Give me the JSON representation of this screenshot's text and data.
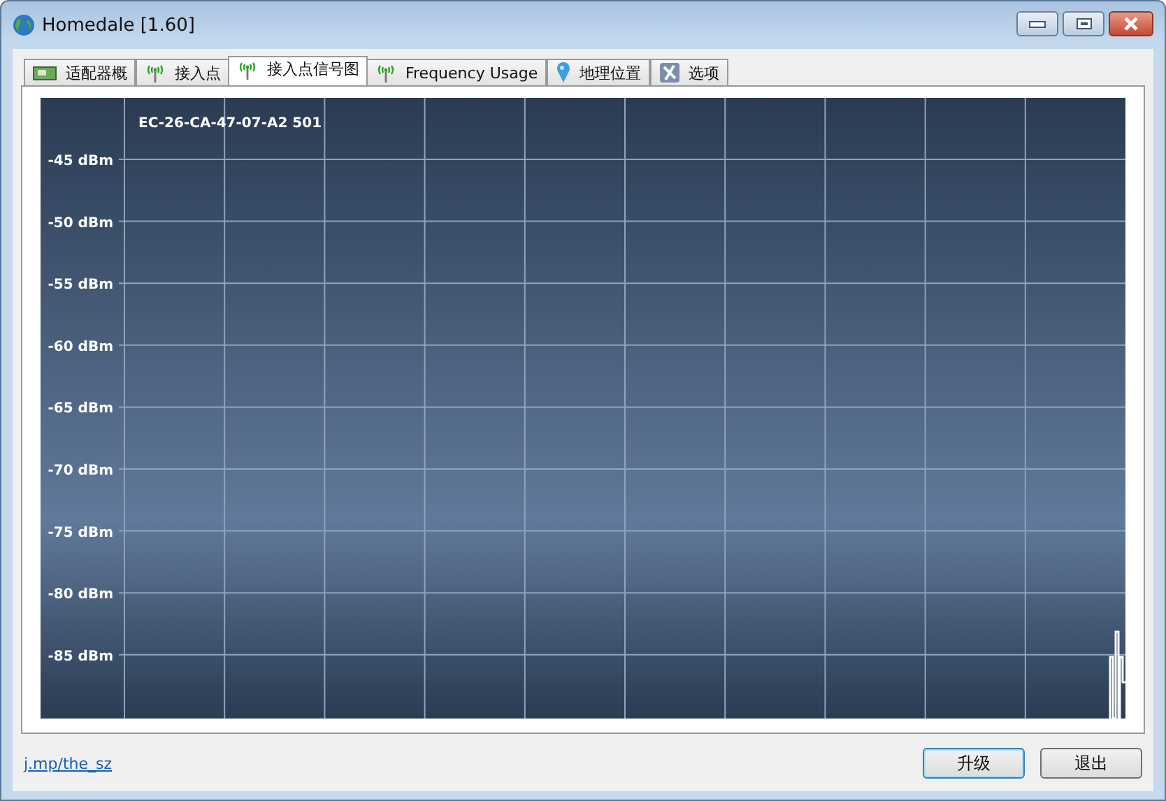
{
  "window": {
    "title": "Homedale [1.60]"
  },
  "tabs": [
    {
      "label": "适配器概",
      "kind": "card",
      "selected": false
    },
    {
      "label": "接入点",
      "kind": "antenna",
      "selected": false
    },
    {
      "label": "接入点信号图",
      "kind": "antenna",
      "selected": true
    },
    {
      "label": "Frequency Usage",
      "kind": "antenna",
      "selected": false
    },
    {
      "label": "地理位置",
      "kind": "pin",
      "selected": false
    },
    {
      "label": "选项",
      "kind": "options",
      "selected": false
    }
  ],
  "chart": {
    "network_label": "EC-26-CA-47-07-A2 501",
    "y_labels": [
      "-45 dBm",
      "-50 dBm",
      "-55 dBm",
      "-60 dBm",
      "-65 dBm",
      "-70 dBm",
      "-75 dBm",
      "-80 dBm",
      "-85 dBm"
    ]
  },
  "footer": {
    "link": "j.mp/the_sz",
    "buttons": [
      {
        "label": "升级",
        "selected": true
      },
      {
        "label": "退出",
        "selected": false
      }
    ]
  }
}
